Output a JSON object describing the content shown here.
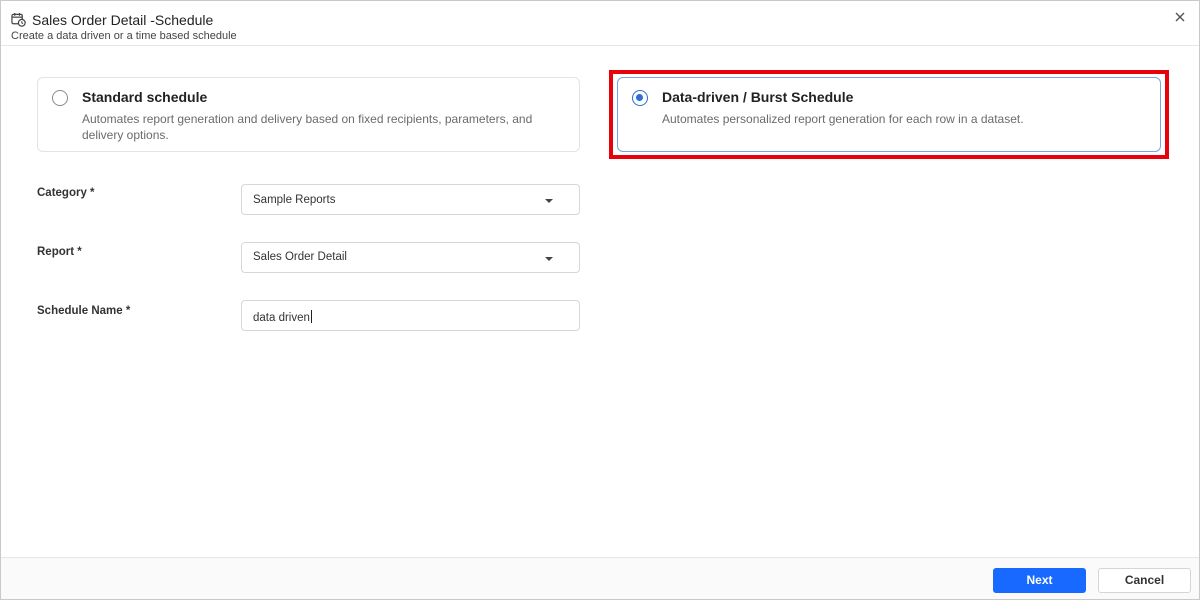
{
  "dialog": {
    "title": "Sales Order Detail -Schedule",
    "subtitle": "Create a data driven or a time based schedule",
    "header_icon": "calendar-clock-icon",
    "close_icon": "close-icon"
  },
  "options": {
    "standard": {
      "title": "Standard schedule",
      "description": "Automates report generation and delivery based on fixed recipients, parameters, and delivery options.",
      "selected": false
    },
    "burst": {
      "title": "Data-driven / Burst Schedule",
      "description": "Automates personalized report generation for each row in a dataset.",
      "selected": true
    }
  },
  "form": {
    "category": {
      "label": "Category *",
      "value": "Sample Reports"
    },
    "report": {
      "label": "Report *",
      "value": "Sales Order Detail"
    },
    "schedule_name": {
      "label": "Schedule Name *",
      "value": "data driven"
    }
  },
  "footer": {
    "next_label": "Next",
    "cancel_label": "Cancel"
  },
  "colors": {
    "primary": "#1769ff",
    "highlight": "#e8000b",
    "radio_selected": "#2a6fdb"
  }
}
